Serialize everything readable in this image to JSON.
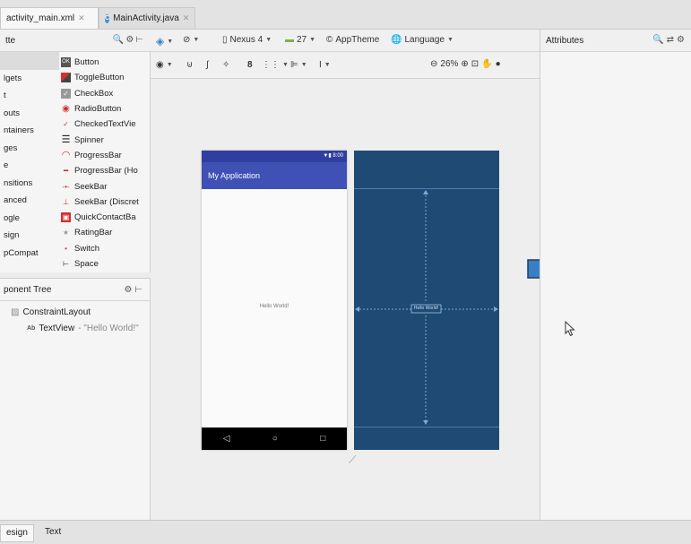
{
  "editor_tabs": [
    {
      "label": "activity_main.xml",
      "active": true
    },
    {
      "label": "MainActivity.java",
      "active": false
    }
  ],
  "palette": {
    "title": "tte",
    "categories": [
      "",
      "lgets",
      "t",
      "outs",
      "ntainers",
      "ges",
      "e",
      "nsitions",
      "anced",
      "ogle",
      "sign",
      "pCompat"
    ],
    "widgets": [
      {
        "label": "Button",
        "icon": "ok-button-icon"
      },
      {
        "label": "ToggleButton",
        "icon": "toggle-button-icon"
      },
      {
        "label": "CheckBox",
        "icon": "checkbox-icon"
      },
      {
        "label": "RadioButton",
        "icon": "radio-button-icon"
      },
      {
        "label": "CheckedTextVie",
        "icon": "checked-text-icon"
      },
      {
        "label": "Spinner",
        "icon": "spinner-icon"
      },
      {
        "label": "ProgressBar",
        "icon": "progress-circle-icon"
      },
      {
        "label": "ProgressBar (Ho",
        "icon": "progress-horizontal-icon"
      },
      {
        "label": "SeekBar",
        "icon": "seekbar-icon"
      },
      {
        "label": "SeekBar (Discret",
        "icon": "seekbar-discrete-icon"
      },
      {
        "label": "QuickContactBa",
        "icon": "quick-contact-icon"
      },
      {
        "label": "RatingBar",
        "icon": "rating-star-icon"
      },
      {
        "label": "Switch",
        "icon": "switch-icon"
      },
      {
        "label": "Space",
        "icon": "space-icon"
      }
    ],
    "widget_button_icon_text": "OK"
  },
  "component_tree": {
    "title": "ponent Tree",
    "root": "ConstraintLayout",
    "child_label": "TextView",
    "child_hint": "- \"Hello World!\"",
    "child_icon_text": "Ab"
  },
  "toolbar": {
    "device": "Nexus 4",
    "api": "27",
    "theme": "AppTheme",
    "language": "Language",
    "zoom": "26%"
  },
  "device_preview": {
    "app_title": "My Application",
    "status_time": "8:00",
    "hello_text": "Hello World!"
  },
  "blueprint": {
    "hello_text": "Hello World!"
  },
  "attributes": {
    "title": "Attributes"
  },
  "bottom_tabs": [
    {
      "label": "esign",
      "active": true
    },
    {
      "label": "Text",
      "active": false
    }
  ],
  "colors": {
    "primary": "#3f51b5",
    "primary_dark": "#303f9f",
    "blueprint": "#1e4a73",
    "arrow": "#3a7fc2"
  }
}
